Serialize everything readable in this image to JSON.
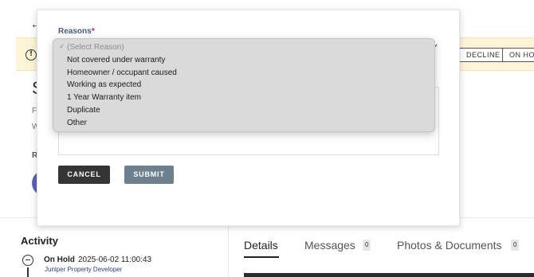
{
  "background": {
    "back_arrow": "←",
    "banner_icon": "!",
    "banner_buttons": [
      "DECLINE",
      "ON HOLD"
    ],
    "heading_fragment": "S",
    "line1_fragment": "Fi",
    "line2_fragment": "W",
    "line3_fragment": "R"
  },
  "activity": {
    "title": "Activity",
    "status": "On Hold",
    "timestamp": "2025-06-02 11:00:43",
    "user": "Juniper Property Developer"
  },
  "tabs": [
    {
      "label": "Details",
      "count": null,
      "active": true
    },
    {
      "label": "Messages",
      "count": "0",
      "active": false
    },
    {
      "label": "Photos & Documents",
      "count": "0",
      "active": false
    }
  ],
  "modal": {
    "reasons_label": "Reasons",
    "required_mark": "*",
    "select_chevron": "✓",
    "cancel_label": "CANCEL",
    "submit_label": "SUBMIT"
  },
  "dropdown": {
    "checkmark": "✓",
    "placeholder": "(Select Reason)",
    "options": [
      "Not covered under warranty",
      "Homeowner / occupant caused",
      "Working as expected",
      "1 Year Warranty item",
      "Duplicate",
      "Other"
    ]
  },
  "colors": {
    "banner_bg": "#fdf3d7",
    "cancel_bg": "#353535",
    "submit_bg": "#6e7f8e",
    "label_color": "#445b78",
    "required_color": "#c62828",
    "avatar_color": "#5b63b7"
  }
}
